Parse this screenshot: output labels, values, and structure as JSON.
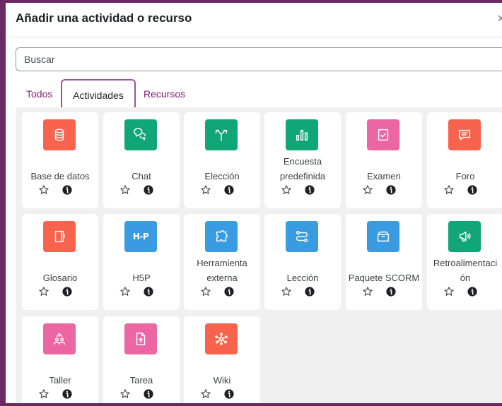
{
  "dialog": {
    "title": "Añadir una actividad o recurso",
    "close_glyph": "×"
  },
  "search": {
    "placeholder": "Buscar",
    "value": ""
  },
  "tabs": [
    {
      "label": "Todos",
      "active": false
    },
    {
      "label": "Actividades",
      "active": true
    },
    {
      "label": "Recursos",
      "active": false
    }
  ],
  "activities": [
    {
      "name": "Base de datos",
      "lines": [
        "Base de datos"
      ],
      "icon": "database-icon",
      "color": "#f7634d"
    },
    {
      "name": "Chat",
      "lines": [
        "Chat"
      ],
      "icon": "chat-icon",
      "color": "#11a676"
    },
    {
      "name": "Elección",
      "lines": [
        "Elección"
      ],
      "icon": "choice-icon",
      "color": "#11a676"
    },
    {
      "name": "Encuesta predefinida",
      "lines": [
        "Encuesta",
        "predefinida"
      ],
      "icon": "survey-icon",
      "color": "#11a676"
    },
    {
      "name": "Examen",
      "lines": [
        "Examen"
      ],
      "icon": "quiz-icon",
      "color": "#eb66a2"
    },
    {
      "name": "Foro",
      "lines": [
        "Foro"
      ],
      "icon": "forum-icon",
      "color": "#f7634d"
    },
    {
      "name": "Glosario",
      "lines": [
        "Glosario"
      ],
      "icon": "glossary-icon",
      "color": "#f7634d"
    },
    {
      "name": "H5P",
      "lines": [
        "H5P"
      ],
      "icon": "h5p-icon",
      "color": "#399be2"
    },
    {
      "name": "Herramienta externa",
      "lines": [
        "Herramienta",
        "externa"
      ],
      "icon": "external-tool-icon",
      "color": "#399be2"
    },
    {
      "name": "Lección",
      "lines": [
        "Lección"
      ],
      "icon": "lesson-icon",
      "color": "#399be2"
    },
    {
      "name": "Paquete SCORM",
      "lines": [
        "Paquete SCORM"
      ],
      "icon": "scorm-package-icon",
      "color": "#399be2"
    },
    {
      "name": "Retroalimentación",
      "lines": [
        "Retroalimentaci",
        "ón"
      ],
      "icon": "feedback-icon",
      "color": "#11a676"
    },
    {
      "name": "Taller",
      "lines": [
        "Taller"
      ],
      "icon": "workshop-icon",
      "color": "#eb66a2"
    },
    {
      "name": "Tarea",
      "lines": [
        "Tarea"
      ],
      "icon": "assignment-icon",
      "color": "#eb66a2"
    },
    {
      "name": "Wiki",
      "lines": [
        "Wiki"
      ],
      "icon": "wiki-icon",
      "color": "#f7634d"
    }
  ],
  "icon_text": {
    "h5p": "H-P"
  }
}
